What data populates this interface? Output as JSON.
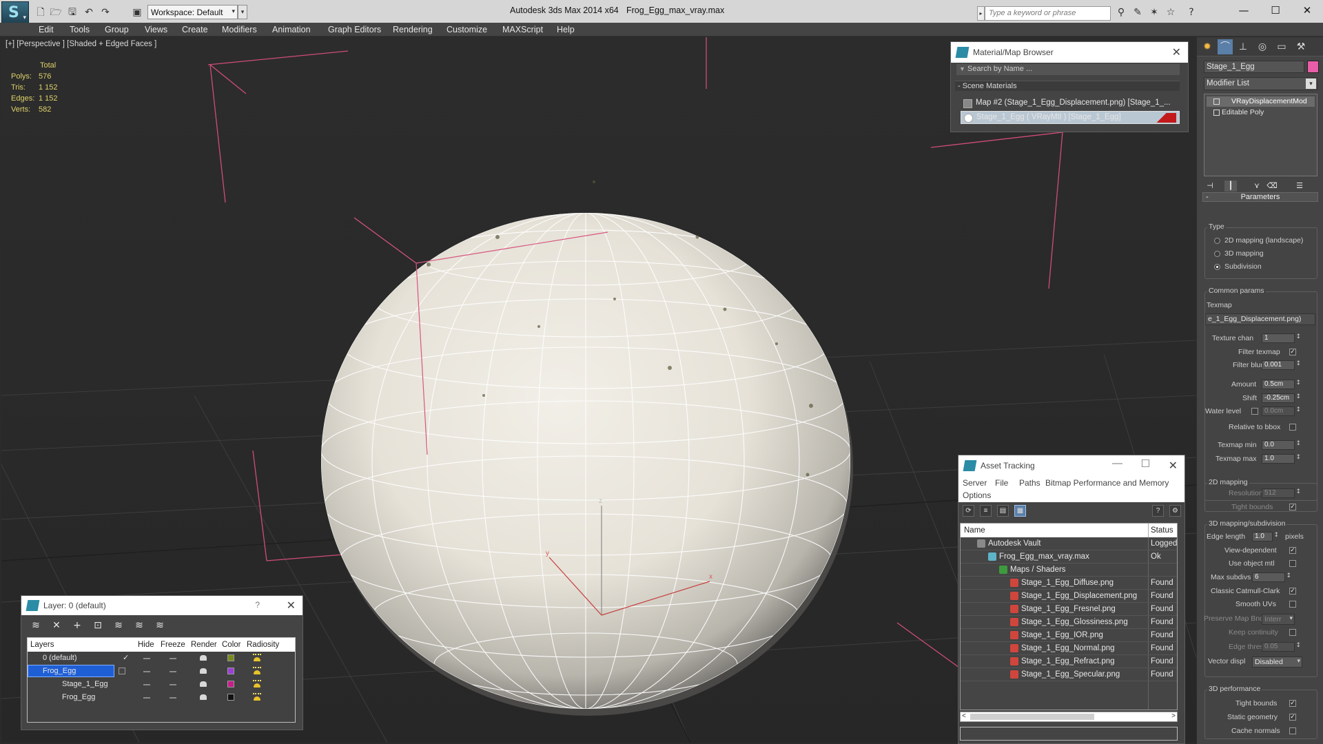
{
  "app": {
    "title": "Autodesk 3ds Max  2014 x64",
    "file": "Frog_Egg_max_vray.max",
    "logo_letter": "S",
    "workspace": "Workspace: Default",
    "search_placeholder": "Type a keyword or phrase"
  },
  "menu": [
    "Edit",
    "Tools",
    "Group",
    "Views",
    "Create",
    "Modifiers",
    "Animation",
    "Graph Editors",
    "Rendering",
    "Customize",
    "MAXScript",
    "Help"
  ],
  "viewport": {
    "label": "[+] [Perspective ] [Shaded + Edged Faces ]",
    "stats_header": "Total",
    "stats": [
      {
        "k": "Polys:",
        "v": "576"
      },
      {
        "k": "Tris:",
        "v": "1 152"
      },
      {
        "k": "Edges:",
        "v": "1 152"
      },
      {
        "k": "Verts:",
        "v": "582"
      }
    ],
    "gizmo_axes": {
      "x": "x",
      "y": "y",
      "z": "z"
    }
  },
  "material_browser": {
    "title": "Material/Map Browser",
    "search_placeholder": "Search by Name ...",
    "section": "- Scene Materials",
    "rows": [
      "Map #2 (Stage_1_Egg_Displacement.png) [Stage_1_...",
      "Stage_1_Egg  ( VRayMtl ) [Stage_1_Egg]"
    ]
  },
  "asset_tracking": {
    "title": "Asset Tracking",
    "menu": [
      "Server",
      "File",
      "Paths",
      "Bitmap Performance and Memory",
      "Options"
    ],
    "columns": [
      "Name",
      "Status"
    ],
    "rows": [
      {
        "name": "Autodesk Vault",
        "status": "Logged"
      },
      {
        "name": "Frog_Egg_max_vray.max",
        "status": "Ok"
      },
      {
        "name": "Maps / Shaders",
        "status": ""
      },
      {
        "name": "Stage_1_Egg_Diffuse.png",
        "status": "Found"
      },
      {
        "name": "Stage_1_Egg_Displacement.png",
        "status": "Found"
      },
      {
        "name": "Stage_1_Egg_Fresnel.png",
        "status": "Found"
      },
      {
        "name": "Stage_1_Egg_Glossiness.png",
        "status": "Found"
      },
      {
        "name": "Stage_1_Egg_IOR.png",
        "status": "Found"
      },
      {
        "name": "Stage_1_Egg_Normal.png",
        "status": "Found"
      },
      {
        "name": "Stage_1_Egg_Refract.png",
        "status": "Found"
      },
      {
        "name": "Stage_1_Egg_Specular.png",
        "status": "Found"
      }
    ]
  },
  "layer_manager": {
    "title": "Layer: 0 (default)",
    "help": "?",
    "columns": [
      "Layers",
      "Hide",
      "Freeze",
      "Render",
      "Color",
      "Radiosity"
    ],
    "rows": [
      {
        "name": "0 (default)",
        "color": "#7a8a1e"
      },
      {
        "name": "Frog_Egg",
        "color": "#9b3fd6"
      },
      {
        "name": "Stage_1_Egg",
        "color": "#c81d8a"
      },
      {
        "name": "Frog_Egg",
        "color": "#111111"
      }
    ]
  },
  "command_panel": {
    "object_name": "Stage_1_Egg",
    "object_color": "#e85ca8",
    "modifier_list": "Modifier List",
    "stack": [
      "VRayDisplacementMod",
      "Editable Poly"
    ],
    "rollout": "Parameters",
    "type_label": "Type",
    "types": [
      "2D mapping (landscape)",
      "3D mapping",
      "Subdivision"
    ],
    "selected_type": "Subdivision",
    "common_params": "Common params",
    "texmap_label": "Texmap",
    "texmap_value": "e_1_Egg_Displacement.png)",
    "texture_chan_label": "Texture chan",
    "texture_chan": "1",
    "filter_texmap": "Filter texmap",
    "filter_blur_label": "Filter blur",
    "filter_blur": "0.001",
    "amount_label": "Amount",
    "amount": "0.5cm",
    "shift_label": "Shift",
    "shift": "-0.25cm",
    "water_level_label": "Water level",
    "water_level": "0.0cm",
    "relative_bbox": "Relative to bbox",
    "texmap_min_label": "Texmap min",
    "texmap_min": "0.0",
    "texmap_max_label": "Texmap max",
    "texmap_max": "1.0",
    "mapping2d": "2D mapping",
    "resolution_label": "Resolution",
    "resolution": "512",
    "tight_bounds": "Tight bounds",
    "mapping3d": "3D mapping/subdivision",
    "edge_length_label": "Edge length",
    "edge_length": "1.0",
    "pixels": "pixels",
    "view_dependent": "View-dependent",
    "use_object_mtl": "Use object mtl",
    "max_subdivs_label": "Max subdivs",
    "max_subdivs": "6",
    "classic_catmull": "Classic Catmull-Clark",
    "smooth_uvs": "Smooth UVs",
    "preserve_map_label": "Preserve Map Bnd",
    "preserve_map": "Interr",
    "keep_continuity": "Keep continuity",
    "edge_thresh_label": "Edge thresh",
    "edge_thresh": "0.05",
    "vector_displ_label": "Vector displ",
    "vector_displ": "Disabled",
    "perf": "3D performance",
    "tight_bounds2": "Tight bounds",
    "static_geometry": "Static geometry",
    "cache_normals": "Cache normals"
  }
}
